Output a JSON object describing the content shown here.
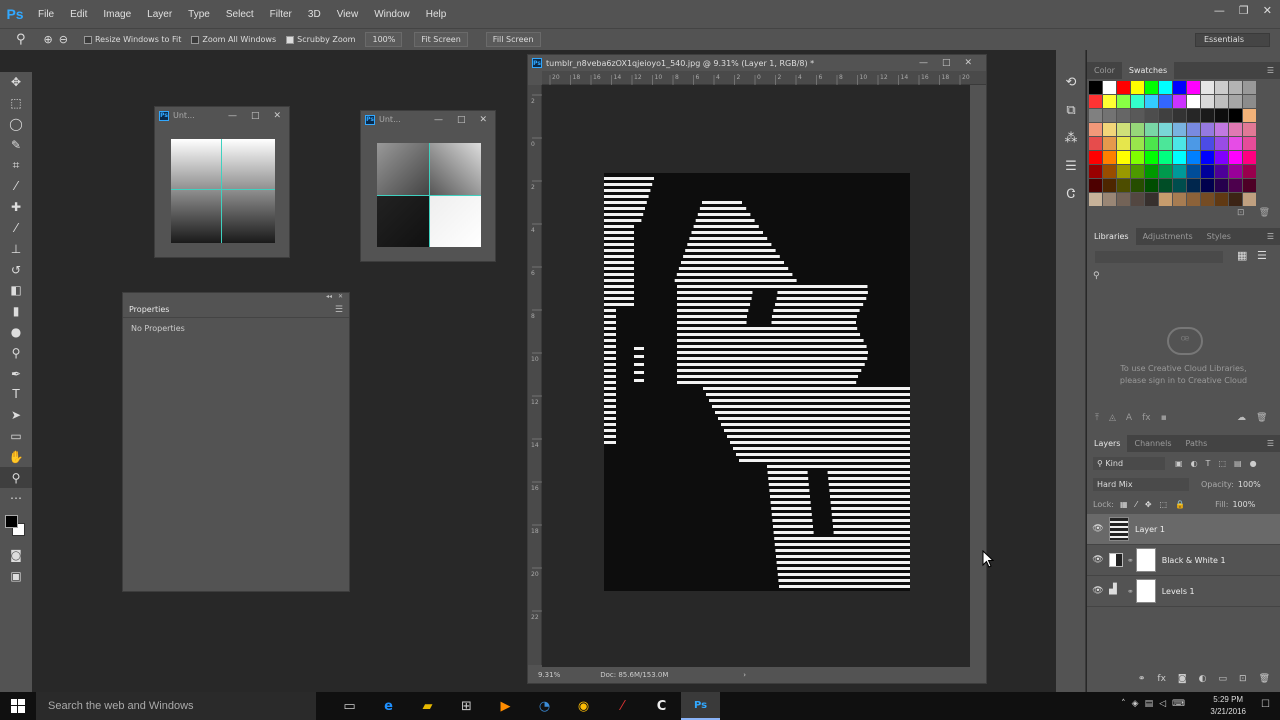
{
  "app": {
    "logo": "Ps"
  },
  "menu": [
    "File",
    "Edit",
    "Image",
    "Layer",
    "Type",
    "Select",
    "Filter",
    "3D",
    "View",
    "Window",
    "Help"
  ],
  "window_controls": [
    "—",
    "❐",
    "✕"
  ],
  "options_bar": {
    "resize_windows": "Resize Windows to Fit",
    "zoom_all": "Zoom All Windows",
    "scrubby_zoom": "Scrubby Zoom",
    "zoom_value": "100%",
    "fit_screen": "Fit Screen",
    "fill_screen": "Fill Screen",
    "workspace": "Essentials"
  },
  "float_window_1": {
    "title": "Unt..."
  },
  "float_window_2": {
    "title": "Unt..."
  },
  "properties_panel": {
    "title": "Properties",
    "content": "No Properties"
  },
  "document": {
    "title": "tumblr_n8veba6zOX1qjeioyo1_540.jpg @ 9.31% (Layer 1, RGB/8) *",
    "zoom": "9.31%",
    "doc_info": "Doc: 85.6M/153.0M",
    "ruler_top": [
      "20",
      "18",
      "16",
      "14",
      "12",
      "10",
      "8",
      "6",
      "4",
      "2",
      "0",
      "2",
      "4",
      "6",
      "8",
      "10",
      "12",
      "14",
      "16",
      "18",
      "20"
    ],
    "ruler_left": [
      "2",
      "0",
      "2",
      "4",
      "6",
      "8",
      "10",
      "12",
      "14",
      "16",
      "18",
      "20",
      "22"
    ]
  },
  "swatches_panel": {
    "tabs": [
      "Color",
      "Swatches"
    ],
    "active_tab": "Swatches",
    "colors": [
      "#000000",
      "#ffffff",
      "#ff0000",
      "#ffff00",
      "#00ff00",
      "#00ffff",
      "#0000ff",
      "#ff00ff",
      "#e5e5e5",
      "#cccccc",
      "#b3b3b3",
      "#999999",
      "#ff3333",
      "#ffff33",
      "#88ff44",
      "#33ffcc",
      "#33ccff",
      "#3366ff",
      "#cc33ff",
      "#ffffff",
      "#d9d9d9",
      "#bfbfbf",
      "#a6a6a6",
      "#8c8c8c",
      "#808080",
      "#737373",
      "#666666",
      "#595959",
      "#4d4d4d",
      "#404040",
      "#333333",
      "#262626",
      "#1a1a1a",
      "#0d0d0d",
      "#000000",
      "#f2b279",
      "#f29879",
      "#f2d679",
      "#cfe079",
      "#96d679",
      "#79d6a6",
      "#79d6d6",
      "#79b3e0",
      "#798ae0",
      "#9679e0",
      "#c279e0",
      "#e079b3",
      "#e07996",
      "#e64c4c",
      "#e6994c",
      "#e6e64c",
      "#99e64c",
      "#4ce64c",
      "#4ce699",
      "#4ce6e6",
      "#4c99e6",
      "#4c4ce6",
      "#994ce6",
      "#e64ce6",
      "#e64c99",
      "#ff0000",
      "#ff8000",
      "#ffff00",
      "#80ff00",
      "#00ff00",
      "#00ff80",
      "#00ffff",
      "#0080ff",
      "#0000ff",
      "#8000ff",
      "#ff00ff",
      "#ff0080",
      "#990000",
      "#994d00",
      "#999900",
      "#4d9900",
      "#009900",
      "#00994d",
      "#009999",
      "#004d99",
      "#000099",
      "#4d0099",
      "#990099",
      "#99004d",
      "#4d0000",
      "#4d2600",
      "#4d4d00",
      "#264d00",
      "#004d00",
      "#004d26",
      "#004d4d",
      "#00264d",
      "#00004d",
      "#26004d",
      "#4d004d",
      "#4d0026",
      "#c7b299",
      "#998675",
      "#736357",
      "#534741",
      "#37302d",
      "#c69c6d",
      "#a67c52",
      "#8c6239",
      "#754c24",
      "#603913",
      "#3c2415",
      "#c0a080"
    ]
  },
  "libraries_panel": {
    "tabs": [
      "Libraries",
      "Adjustments",
      "Styles"
    ],
    "message_line1": "To use Creative Cloud Libraries,",
    "message_line2": "please sign in to Creative Cloud"
  },
  "layers_panel": {
    "tabs": [
      "Layers",
      "Channels",
      "Paths"
    ],
    "filter": "Kind",
    "blend_mode": "Hard Mix",
    "opacity_label": "Opacity:",
    "opacity": "100%",
    "lock_label": "Lock:",
    "fill_label": "Fill:",
    "fill": "100%",
    "layers": [
      {
        "name": "Layer 1",
        "selected": true
      },
      {
        "name": "Black & White 1",
        "selected": false
      },
      {
        "name": "Levels 1",
        "selected": false
      }
    ]
  },
  "taskbar": {
    "search_placeholder": "Search the web and Windows",
    "time": "5:29 PM",
    "date": "3/21/2016"
  }
}
